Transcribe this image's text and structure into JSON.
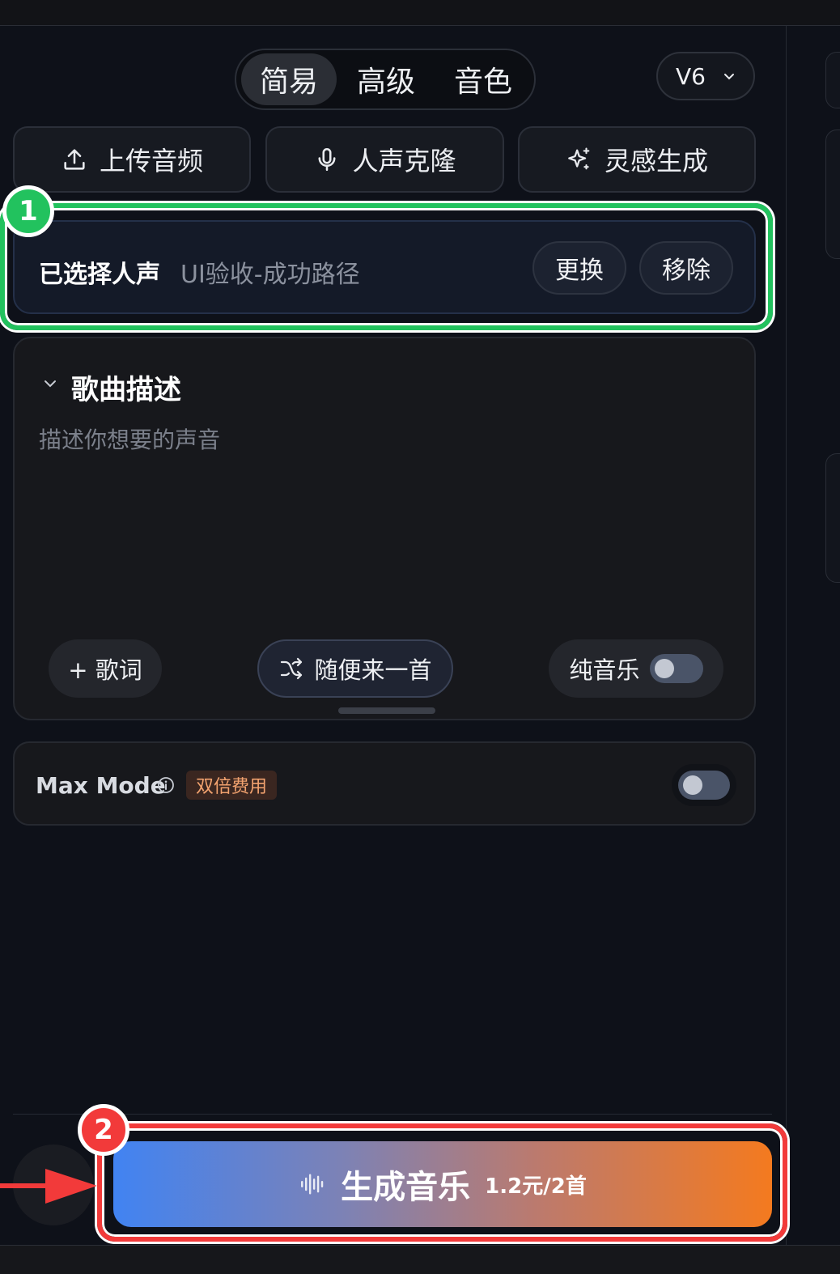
{
  "mode_tabs": {
    "simple": "简易",
    "advanced": "高级",
    "timbre": "音色"
  },
  "version": {
    "label": "V6"
  },
  "actions": {
    "upload": "上传音频",
    "clone": "人声克隆",
    "inspire": "灵感生成"
  },
  "voice": {
    "label": "已选择人声",
    "name": "UI验收-成功路径",
    "replace": "更换",
    "remove": "移除"
  },
  "description": {
    "title": "歌曲描述",
    "placeholder": "描述你想要的声音",
    "lyrics_chip": "+ 歌词",
    "random_chip": "随便来一首",
    "instrumental_label": "纯音乐",
    "instrumental_on": false
  },
  "max_mode": {
    "label": "Max Mode",
    "badge": "双倍费用",
    "enabled": false
  },
  "generate": {
    "label": "生成音乐",
    "price": "1.2元/2首"
  },
  "annotations": {
    "first": "1",
    "second": "2"
  },
  "colors": {
    "highlight_green": "#22c25e",
    "highlight_red": "#f23a3a",
    "gradient_start": "#4183f2",
    "gradient_end": "#f47a1f",
    "badge_orange": "#f3a36f"
  },
  "icons": [
    "upload-icon",
    "mic-icon",
    "sparkle-icon",
    "chevron-down-icon",
    "shuffle-icon",
    "info-icon",
    "waveform-icon"
  ]
}
